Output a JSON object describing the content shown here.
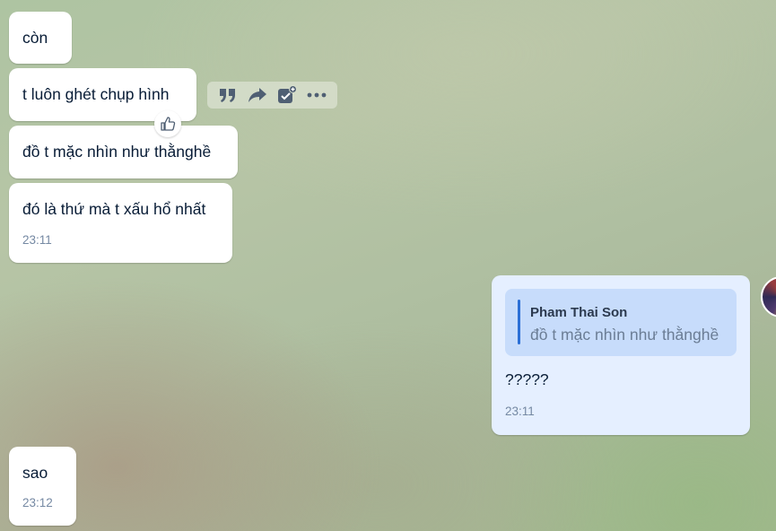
{
  "messages": [
    {
      "text": "còn"
    },
    {
      "text": "t luôn ghét chụp hình"
    },
    {
      "text": "đồ t mặc nhìn như thằnghề"
    },
    {
      "text": "đó là thứ mà t xấu hổ nhất",
      "time": "23:11"
    },
    {
      "text": "sao",
      "time": "23:12"
    }
  ],
  "reply": {
    "quote_author": "Pham Thai Son",
    "quote_text": "đồ t mặc nhìn như thằnghề",
    "text": "?????",
    "time": "23:11"
  },
  "toolbar": {
    "icons": [
      "quote-icon",
      "forward-icon",
      "add-task-icon",
      "more-icon"
    ]
  },
  "reaction": {
    "icon": "thumbs-up-icon"
  },
  "colors": {
    "bubble_received": "#ffffff",
    "bubble_sent": "#e5efff",
    "quote_background": "#c7dcfb",
    "quote_accent": "#2b6fd6",
    "timestamp": "#7589a3"
  }
}
